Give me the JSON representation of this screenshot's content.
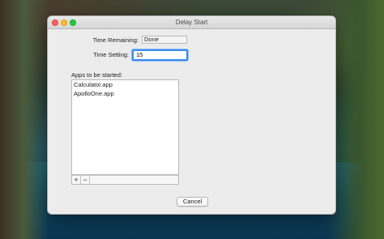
{
  "window": {
    "title": "Delay Start"
  },
  "form": {
    "time_remaining_label": "Time Remaining:",
    "time_remaining_value": "Done",
    "time_setting_label": "Time Setting:",
    "time_setting_value": "15"
  },
  "apps": {
    "label": "Apps to be started:",
    "items": [
      "Calculator.app",
      "ApolloOne.app"
    ],
    "add_label": "+",
    "remove_label": "−"
  },
  "buttons": {
    "cancel_label": "Cancel"
  }
}
